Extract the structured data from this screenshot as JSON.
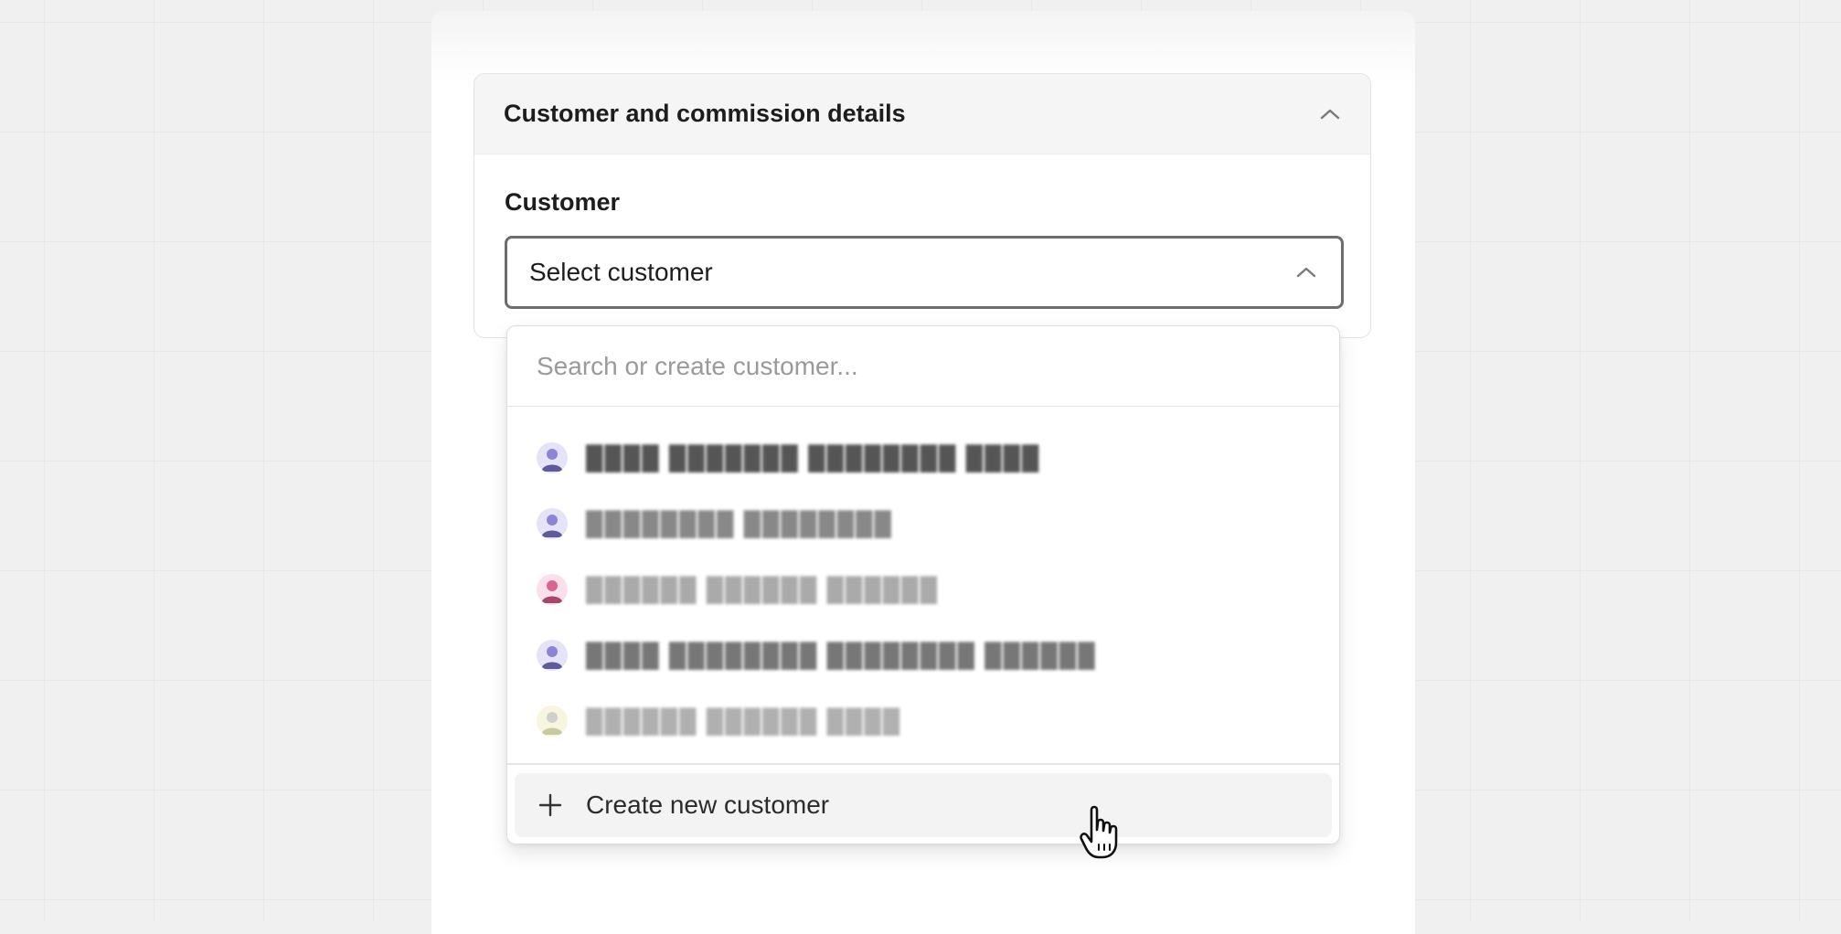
{
  "section": {
    "title": "Customer and commission details"
  },
  "customer_field": {
    "label": "Customer",
    "value": "Select customer"
  },
  "dropdown": {
    "search_placeholder": "Search or create customer...",
    "items": [
      {
        "name": "████ ███████ ████████ ████",
        "avatar_color": "#8a85d6",
        "avatar_bg": "#e4e3f7",
        "icon": "user-avatar-icon"
      },
      {
        "name": "████████ ████████",
        "avatar_color": "#8a85d6",
        "avatar_bg": "#e4e3f7",
        "icon": "user-avatar-icon"
      },
      {
        "name": "██████ ██████ ██████",
        "avatar_color": "#d9668f",
        "avatar_bg": "#f9e0ea",
        "icon": "user-avatar-icon"
      },
      {
        "name": "████ ████████ ████████ ██████",
        "avatar_color": "#8a85d6",
        "avatar_bg": "#e4e3f7",
        "icon": "user-avatar-icon"
      },
      {
        "name": "██████ ██████ ████",
        "avatar_color": "#c9c9a0",
        "avatar_bg": "#f7f5df",
        "icon": "user-avatar-icon"
      }
    ],
    "create_label": "Create new customer"
  },
  "colors": {
    "text": "#1d1d1d",
    "select_border": "#6d6d6d",
    "header_bg": "#f5f5f5"
  }
}
